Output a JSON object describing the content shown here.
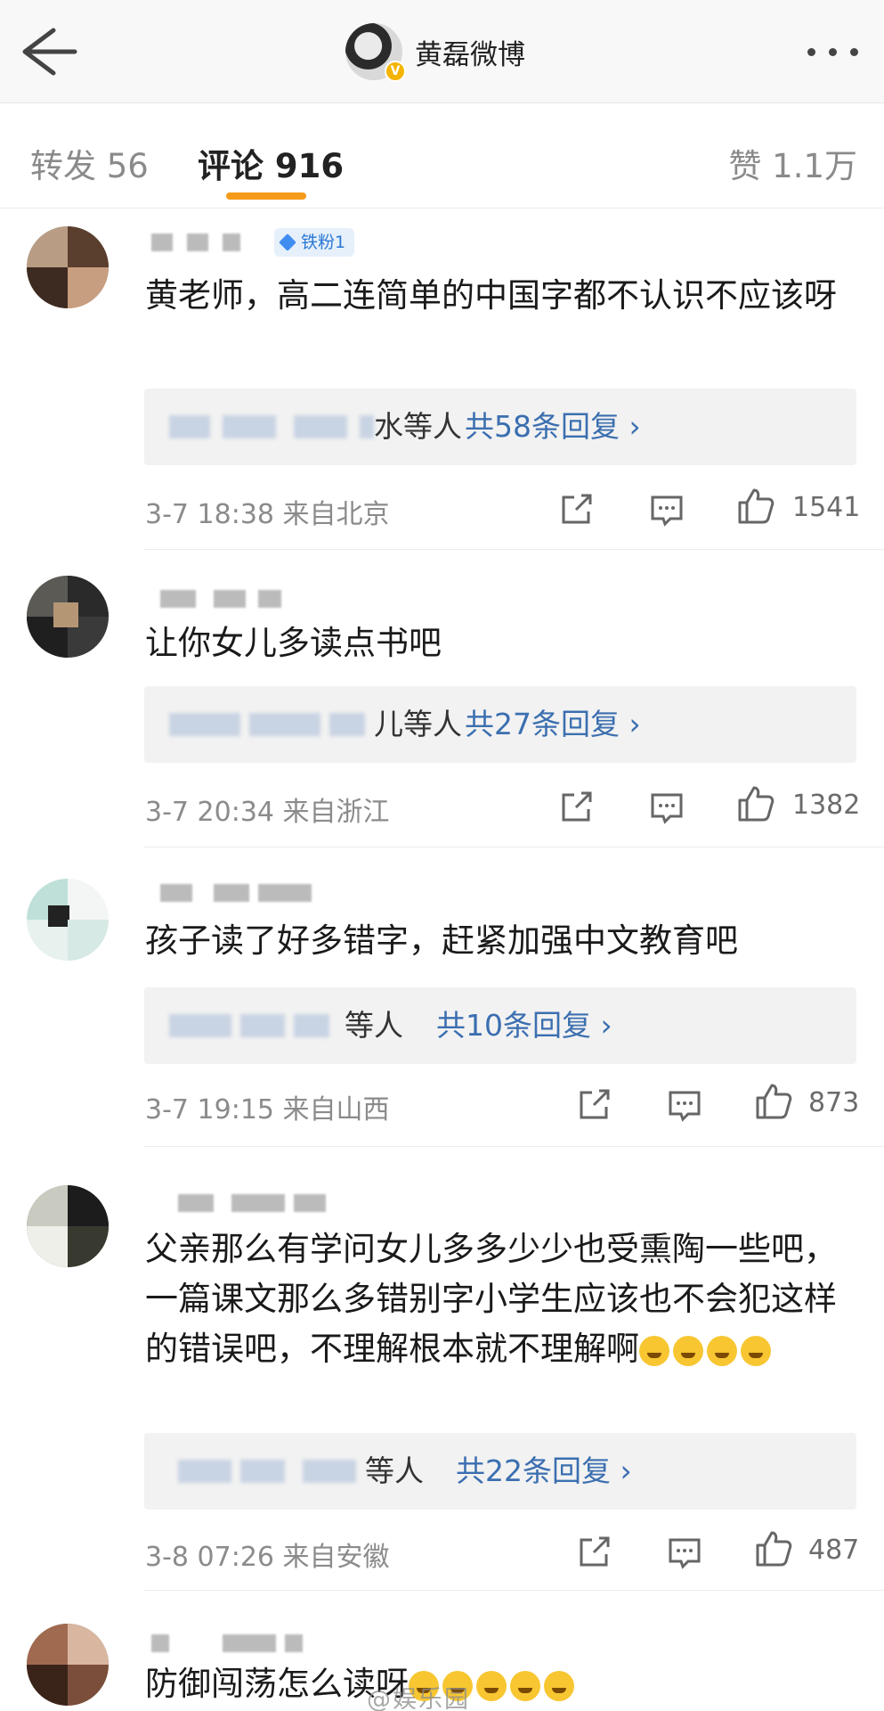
{
  "header": {
    "title": "黄磊微博",
    "back_icon": "arrow-left-icon",
    "more_icon": "more-horizontal-icon",
    "verified_badge": "V"
  },
  "tabs": {
    "repost": "转发 56",
    "comments": "评论 916",
    "likes": "赞 1.1万",
    "active_color": "#f59b1b"
  },
  "comments": [
    {
      "badge": "铁粉1",
      "text": "黄老师，高二连简单的中国字都不认识不应该呀",
      "reply_who": "水等人",
      "reply_count": "共58条回复 ›",
      "time": "3-7 18:38",
      "location": "来自北京",
      "likes": "1541"
    },
    {
      "text": "让你女儿多读点书吧",
      "reply_who": "儿等人",
      "reply_count": "共27条回复 ›",
      "time": "3-7 20:34",
      "location": "来自浙江",
      "likes": "1382"
    },
    {
      "text": "孩子读了好多错字，赶紧加强中文教育吧",
      "reply_who": "等人",
      "reply_count": "共10条回复 ›",
      "time": "3-7 19:15",
      "location": "来自山西",
      "likes": "873"
    },
    {
      "text": "父亲那么有学问女儿多多少少也受熏陶一些吧，一篇课文那么多错别字小学生应该也不会犯这样的错误吧，不理解根本就不理解啊",
      "reply_who": "等人",
      "reply_count": "共22条回复 ›",
      "time": "3-8 07:26",
      "location": "来自安徽",
      "likes": "487"
    },
    {
      "text": "防御闯荡怎么读呀"
    }
  ],
  "watermark": "@娱乐园",
  "colors": {
    "link_blue": "#3b6fb0",
    "fan_badge_bg": "#e6f0fb",
    "fan_badge_text": "#2b78d4"
  }
}
